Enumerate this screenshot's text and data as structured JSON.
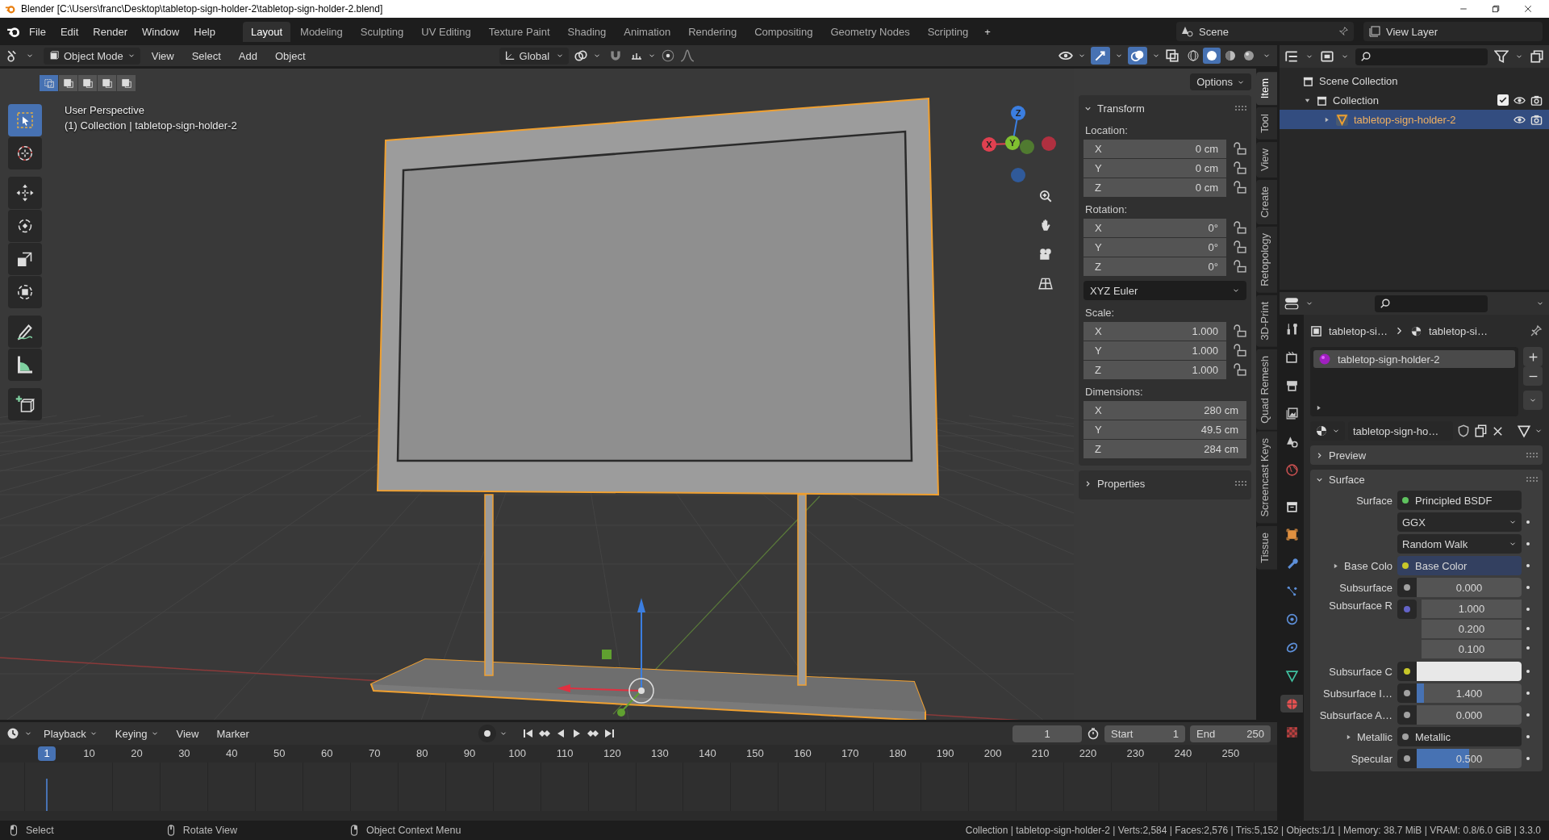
{
  "window": {
    "title": "Blender [C:\\Users\\franc\\Desktop\\tabletop-sign-holder-2\\tabletop-sign-holder-2.blend]"
  },
  "menu": [
    "File",
    "Edit",
    "Render",
    "Window",
    "Help"
  ],
  "workspaces": [
    {
      "label": "Layout",
      "selected": true
    },
    {
      "label": "Modeling",
      "selected": false
    },
    {
      "label": "Sculpting",
      "selected": false
    },
    {
      "label": "UV Editing",
      "selected": false
    },
    {
      "label": "Texture Paint",
      "selected": false
    },
    {
      "label": "Shading",
      "selected": false
    },
    {
      "label": "Animation",
      "selected": false
    },
    {
      "label": "Rendering",
      "selected": false
    },
    {
      "label": "Compositing",
      "selected": false
    },
    {
      "label": "Geometry Nodes",
      "selected": false
    },
    {
      "label": "Scripting",
      "selected": false
    }
  ],
  "add_workspace": "+",
  "scene": "Scene",
  "view_layer": "View Layer",
  "viewport": {
    "mode": "Object Mode",
    "menus": [
      "View",
      "Select",
      "Add",
      "Object"
    ],
    "orientation": "Global",
    "options": "Options",
    "select_modes": [
      {
        "selected": true
      },
      {
        "selected": false
      },
      {
        "selected": false
      },
      {
        "selected": false
      },
      {
        "selected": false
      }
    ],
    "shading": [
      {
        "kind": "wireframe",
        "selected": false
      },
      {
        "kind": "solid",
        "selected": true
      },
      {
        "kind": "material",
        "selected": false
      },
      {
        "kind": "rendered",
        "selected": false
      }
    ],
    "tools": [
      {
        "kind": "select",
        "selected": true
      },
      {
        "kind": "cursor",
        "selected": false
      },
      {
        "kind": "move",
        "selected": false
      },
      {
        "kind": "rotate",
        "selected": false
      },
      {
        "kind": "scale",
        "selected": false
      },
      {
        "kind": "transform",
        "selected": false
      },
      {
        "kind": "annotate",
        "selected": false
      },
      {
        "kind": "measure",
        "selected": false
      },
      {
        "kind": "add-cube",
        "selected": false
      }
    ],
    "overlay": [
      "User Perspective",
      "(1) Collection | tabletop-sign-holder-2"
    ],
    "nav_axes": [
      "X",
      "Y",
      "Z"
    ]
  },
  "sidebar": {
    "tabs": [
      {
        "label": "Item",
        "selected": true
      },
      {
        "label": "Tool",
        "selected": false
      },
      {
        "label": "View",
        "selected": false
      },
      {
        "label": "Create",
        "selected": false
      },
      {
        "label": "Retopology",
        "selected": false
      },
      {
        "label": "3D-Print",
        "selected": false
      },
      {
        "label": "Quad Remesh",
        "selected": false
      },
      {
        "label": "Screencast Keys",
        "selected": false
      },
      {
        "label": "Tissue",
        "selected": false
      }
    ],
    "transform": {
      "title": "Transform",
      "expanded": true,
      "groups": [
        {
          "kind": "vector",
          "label": "Location:",
          "locked": false,
          "fields": [
            {
              "axis": "X",
              "value": "0 cm"
            },
            {
              "axis": "Y",
              "value": "0 cm"
            },
            {
              "axis": "Z",
              "value": "0 cm"
            }
          ]
        },
        {
          "kind": "vector",
          "label": "Rotation:",
          "locked": false,
          "fields": [
            {
              "axis": "X",
              "value": "0°"
            },
            {
              "axis": "Y",
              "value": "0°"
            },
            {
              "axis": "Z",
              "value": "0°"
            }
          ]
        },
        {
          "kind": "dropdown",
          "value": "XYZ Euler"
        },
        {
          "kind": "vector",
          "label": "Scale:",
          "locked": false,
          "fields": [
            {
              "axis": "X",
              "value": "1.000"
            },
            {
              "axis": "Y",
              "value": "1.000"
            },
            {
              "axis": "Z",
              "value": "1.000"
            }
          ]
        },
        {
          "kind": "wide",
          "label": "Dimensions:",
          "fields": [
            {
              "axis": "X",
              "value": "280 cm"
            },
            {
              "axis": "Y",
              "value": "49.5 cm"
            },
            {
              "axis": "Z",
              "value": "284 cm"
            }
          ]
        }
      ]
    },
    "properties_panel": {
      "title": "Properties",
      "expanded": false
    }
  },
  "outliner": {
    "root": "Scene Collection",
    "items": [
      {
        "label": "Collection",
        "expanded": true,
        "checked": true,
        "children": [
          {
            "label": "tabletop-sign-holder-2",
            "selected": true,
            "expanded": false
          }
        ]
      }
    ]
  },
  "properties": {
    "tabs": [
      {
        "kind": "tool",
        "selected": false
      },
      {
        "kind": "render",
        "selected": false
      },
      {
        "kind": "output",
        "selected": false
      },
      {
        "kind": "view_layer",
        "selected": false
      },
      {
        "kind": "scene",
        "selected": false
      },
      {
        "kind": "world",
        "selected": false
      },
      {
        "kind": "collection",
        "selected": false
      },
      {
        "kind": "object",
        "selected": false
      },
      {
        "kind": "modifiers",
        "selected": false
      },
      {
        "kind": "particles",
        "selected": false
      },
      {
        "kind": "physics",
        "selected": false
      },
      {
        "kind": "constraints",
        "selected": false
      },
      {
        "kind": "data",
        "selected": false
      },
      {
        "kind": "material",
        "selected": true
      },
      {
        "kind": "texture",
        "selected": false
      }
    ],
    "breadcrumbs": [
      "tabletop-si…",
      "tabletop-si…"
    ],
    "slots": [
      {
        "name": "tabletop-sign-holder-2",
        "selected": true
      }
    ],
    "material": "tabletop-sign-ho…",
    "panels": [
      {
        "label": "Preview",
        "expanded": false
      },
      {
        "label": "Surface",
        "expanded": true
      }
    ],
    "rows": [
      {
        "kind": "shader",
        "label": "Surface",
        "value": "Principled BSDF",
        "color": "#5fc35f"
      },
      {
        "kind": "dropdown",
        "value": "GGX"
      },
      {
        "kind": "dropdown",
        "value": "Random Walk"
      },
      {
        "kind": "link",
        "label": "Base Colo",
        "value": "Base Color",
        "color": "#c7c729",
        "expanded": false
      },
      {
        "kind": "number",
        "label": "Subsurface",
        "value": "0.000",
        "color": "#a1a1a1",
        "level": 0
      },
      {
        "kind": "vector",
        "label": "Subsurface R",
        "color": "#6363c7",
        "values": [
          "1.000",
          "0.200",
          "0.100"
        ]
      },
      {
        "kind": "swatch",
        "label": "Subsurface C",
        "color": "#c7c729"
      },
      {
        "kind": "number",
        "label": "Subsurface I…",
        "value": "1.400",
        "color": "#a1a1a1",
        "level": 0.07
      },
      {
        "kind": "number",
        "label": "Subsurface A…",
        "value": "0.000",
        "color": "#a1a1a1",
        "level": 0
      },
      {
        "kind": "link",
        "label": "Metallic",
        "value": "Metallic",
        "color": "#a1a1a1",
        "expanded": false
      },
      {
        "kind": "number",
        "label": "Specular",
        "value": "0.500",
        "color": "#a1a1a1",
        "level": 0.5
      }
    ]
  },
  "timeline": {
    "menus": [
      "Playback",
      "Keying",
      "View",
      "Marker"
    ],
    "current": "1",
    "start_label": "Start",
    "start": "1",
    "end_label": "End",
    "end": "250",
    "playhead": "1",
    "ticks": [
      "10",
      "20",
      "30",
      "40",
      "50",
      "60",
      "70",
      "80",
      "90",
      "100",
      "110",
      "120",
      "130",
      "140",
      "150",
      "160",
      "170",
      "180",
      "190",
      "200",
      "210",
      "220",
      "230",
      "240",
      "250"
    ]
  },
  "status_bar": {
    "hints": [
      "Select",
      "Rotate View",
      "Object Context Menu"
    ],
    "stats": "Collection | tabletop-sign-holder-2 | Verts:2,584 | Faces:2,576 | Tris:5,152 | Objects:1/1 | Memory: 38.7 MiB | VRAM: 0.8/6.0 GiB | 3.3.0"
  }
}
